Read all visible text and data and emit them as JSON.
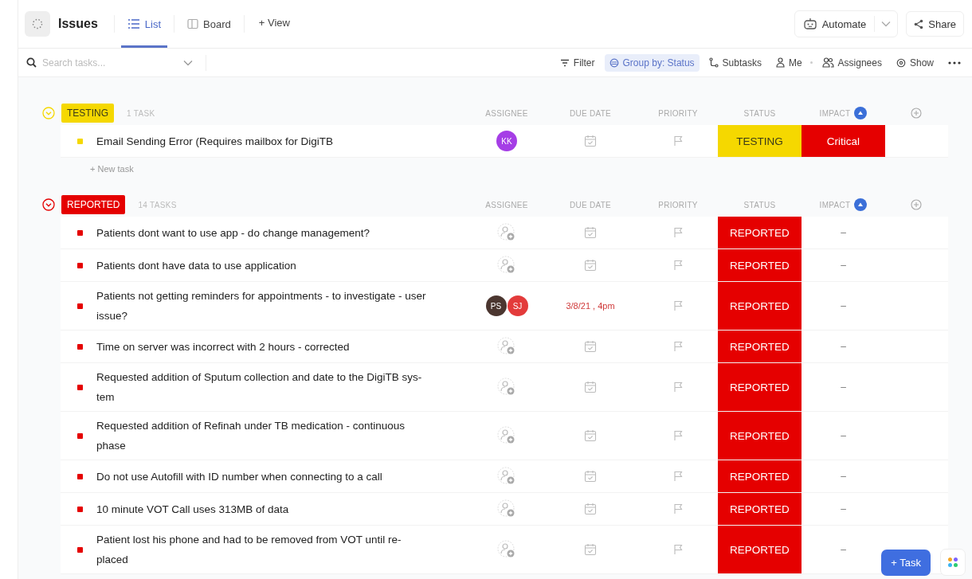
{
  "header": {
    "title": "Issues",
    "tabs": [
      {
        "label": "List",
        "selected": true
      },
      {
        "label": "Board",
        "selected": false
      }
    ],
    "add_view": "+ View",
    "automate": "Automate",
    "share": "Share"
  },
  "toolbar": {
    "search_placeholder": "Search tasks...",
    "items": [
      {
        "label": "Filter",
        "active": false
      },
      {
        "label": "Group by: Status",
        "active": true
      },
      {
        "label": "Subtasks",
        "active": false
      },
      {
        "label": "Me",
        "active": false
      },
      {
        "label": "Assignees",
        "active": false
      },
      {
        "label": "Show",
        "active": false
      }
    ]
  },
  "groups": [
    {
      "status": "TESTING",
      "color": "#f5d800",
      "count": "1 TASK",
      "expanded": true,
      "columns": [
        "ASSIGNEE",
        "DUE DATE",
        "PRIORITY",
        "STATUS",
        "IMPACT"
      ],
      "new_task": "+ New task",
      "tasks": [
        {
          "name": "Email Sending Error (Requires mailbox for DigiTB",
          "assignees": [
            {
              "initials": "KK",
              "color": "#a53ee6"
            }
          ],
          "status": "TESTING",
          "impact": {
            "label": "Critical",
            "color": "#e50000"
          }
        }
      ]
    },
    {
      "status": "REPORTED",
      "color": "#e50000",
      "count": "14 TASKS",
      "expanded": true,
      "columns": [
        "ASSIGNEE",
        "DUE DATE",
        "PRIORITY",
        "STATUS",
        "IMPACT"
      ],
      "tasks": [
        {
          "name": "Patients dont want to use app - do change management?",
          "status": "REPORTED",
          "impact": {
            "label": "–"
          }
        },
        {
          "name": "Patients dont have data to use application",
          "status": "REPORTED",
          "impact": {
            "label": "–"
          }
        },
        {
          "name": "Patients not getting reminders for appointments - to investigate - user\nissue?",
          "assignees": [
            {
              "initials": "PS",
              "color": "#4b3630"
            },
            {
              "initials": "SJ",
              "color": "#e33b3b"
            }
          ],
          "due": "3/8/21 , 4pm",
          "status": "REPORTED",
          "impact": {
            "label": "–"
          }
        },
        {
          "name": "Time on server was incorrect with 2 hours - corrected",
          "status": "REPORTED",
          "impact": {
            "label": "–"
          }
        },
        {
          "name": "Requested addition of Sputum collection and date to the DigiTB sys-\ntem",
          "status": "REPORTED",
          "impact": {
            "label": "–"
          }
        },
        {
          "name": "Requested addition of Refinah under TB medication - continuous\nphase",
          "status": "REPORTED",
          "impact": {
            "label": "–"
          }
        },
        {
          "name": "Do not use Autofill with ID number when connecting to a call",
          "status": "REPORTED",
          "impact": {
            "label": "–"
          }
        },
        {
          "name": "10 minute VOT Call uses 313MB of data",
          "status": "REPORTED",
          "impact": {
            "label": "–"
          }
        },
        {
          "name": "Patient lost his phone and had to be removed from VOT until re-\nplaced",
          "status": "REPORTED",
          "impact": {
            "label": "–"
          }
        }
      ]
    }
  ],
  "fab": {
    "label": "+ Task"
  }
}
